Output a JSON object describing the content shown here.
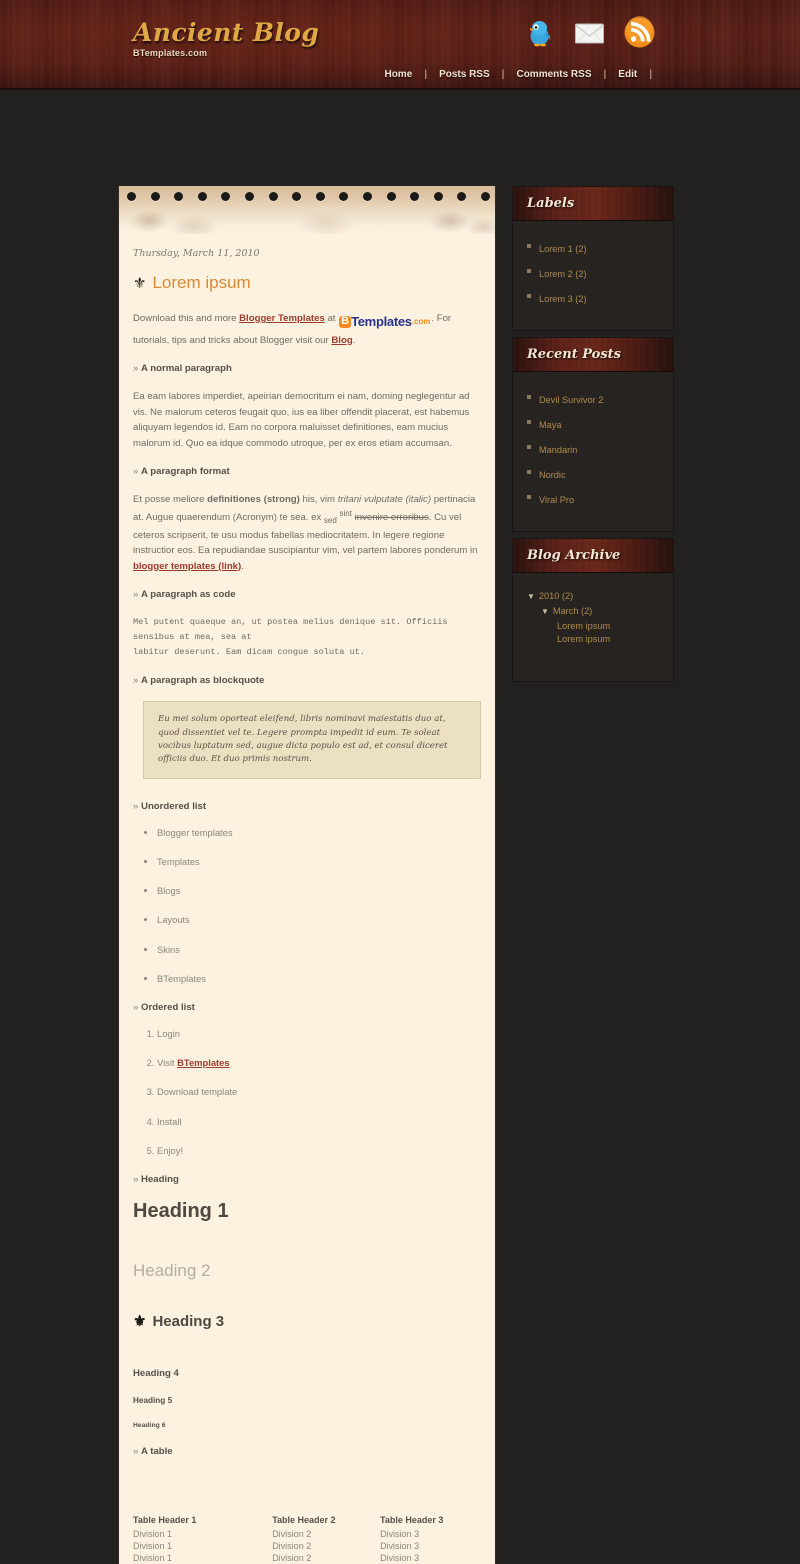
{
  "header": {
    "title": "Ancient Blog",
    "subtitle": "BTemplates.com",
    "social": [
      {
        "name": "twitter-icon",
        "label": "Twitter"
      },
      {
        "name": "email-icon",
        "label": "Email"
      },
      {
        "name": "rss-icon",
        "label": "RSS"
      }
    ],
    "nav": [
      "Home",
      "Posts RSS",
      "Comments RSS",
      "Edit"
    ],
    "separator": "|"
  },
  "post": {
    "date": "Thursday, March 11, 2010",
    "title": "Lorem ipsum",
    "intro": {
      "before_link": "Download this and more ",
      "link1": "Blogger Templates",
      "mid": " at ",
      "logo_b": "B",
      "logo_text": "Templates",
      "logo_com": ".com",
      "after_logo": ". For tutorials, tips and tricks about Blogger visit our ",
      "link2": "Blog",
      "end": "."
    },
    "sections": {
      "normal_paragraph": "A normal paragraph",
      "paragraph_format": "A paragraph format",
      "paragraph_code": "A paragraph as code",
      "paragraph_blockquote": "A paragraph as blockquote",
      "unordered_list": "Unordered list",
      "ordered_list": "Ordered list",
      "heading": "Heading",
      "table": "A table"
    },
    "normal_text": "Ea eam labores imperdiet, apeirian democritum ei nam, doming neglegentur ad vis. Ne malorum ceteros feugait quo, ius ea liber offendit placerat, est habemus aliquyam legendos id. Eam no corpora maluisset definitiones, eam mucius malorum id. Quo ea idque commodo utroque, per ex eros etiam accumsan.",
    "format_text": {
      "p1": "Et posse meliore ",
      "strong": "definitiones (strong)",
      "p2": " his, vim ",
      "italic": "tritani vulputate (italic)",
      "p3": " pertinacia at. Augue quaerendum (Acronym) te sea. ex ",
      "sub": "sed",
      "sup": "sint",
      "strike": "invenire erroribus",
      "p4": ". Cu vel ceteros scripserit, te usu modus fabellas mediocritatem. In legere regione instructior eos. Ea repudiandae suscipiantur vim, vel partem labores ponderum in ",
      "link": "blogger templates (link)",
      "p5": "."
    },
    "code_text": "Mel putent quaeque an, ut postea melius denique sit. Officiis sensibus at mea, sea at\nlabitur deserunt. Eam dicam congue soluta ut.",
    "blockquote_text": "Eu mei solum oporteat eleifend, libris nominavi maiestatis duo at, quod dissentiet vel te. Legere prompta impedit id eum. Te soleat vocibus luptatum sed, augue dicta populo est ad, et consul diceret officiis duo. Et duo primis nostrum.",
    "unordered_items": [
      "Blogger templates",
      "Templates",
      "Blogs",
      "Layouts",
      "Skins",
      "BTemplates"
    ],
    "ordered_items": [
      {
        "text": "Login",
        "link": ""
      },
      {
        "text": "Visit ",
        "link": "BTemplates"
      },
      {
        "text": "Download template",
        "link": ""
      },
      {
        "text": "Install",
        "link": ""
      },
      {
        "text": "Enjoy!",
        "link": ""
      }
    ],
    "headings": {
      "h1": "Heading 1",
      "h2": "Heading 2",
      "h3": "Heading 3",
      "h4": "Heading 4",
      "h5": "Heading 5",
      "h6": "Heading 6"
    },
    "table": {
      "headers": [
        "Table Header 1",
        "Table Header 2",
        "Table Header 3"
      ],
      "rows": [
        [
          "Division 1",
          "Division 2",
          "Division 3"
        ],
        [
          "Division 1",
          "Division 2",
          "Division 3"
        ],
        [
          "Division 1",
          "Division 2",
          "Division 3"
        ]
      ]
    }
  },
  "sidebar": {
    "labels": {
      "title": "Labels",
      "items": [
        {
          "label": "Lorem 1",
          "count": "(2)"
        },
        {
          "label": "Lorem 2",
          "count": "(2)"
        },
        {
          "label": "Lorem 3",
          "count": "(2)"
        }
      ]
    },
    "recent_posts": {
      "title": "Recent Posts",
      "items": [
        "Devil Survivor 2",
        "Maya",
        "Mandarin",
        "Nordic",
        "Viral Pro"
      ]
    },
    "blog_archive": {
      "title": "Blog Archive",
      "triangle": "▼",
      "year": "2010",
      "year_count": "(2)",
      "month": "March",
      "month_count": "(2)",
      "posts": [
        "Lorem ipsum",
        "Lorem ipsum"
      ]
    }
  },
  "colors": {
    "accent_gold": "#e0a845",
    "title_orange": "#d98a33",
    "link_red": "#9c3b2e",
    "sidebar_link": "#b08b4f",
    "paper": "#fcf2df",
    "page_bg": "#232120",
    "wood": "#5c2016"
  }
}
